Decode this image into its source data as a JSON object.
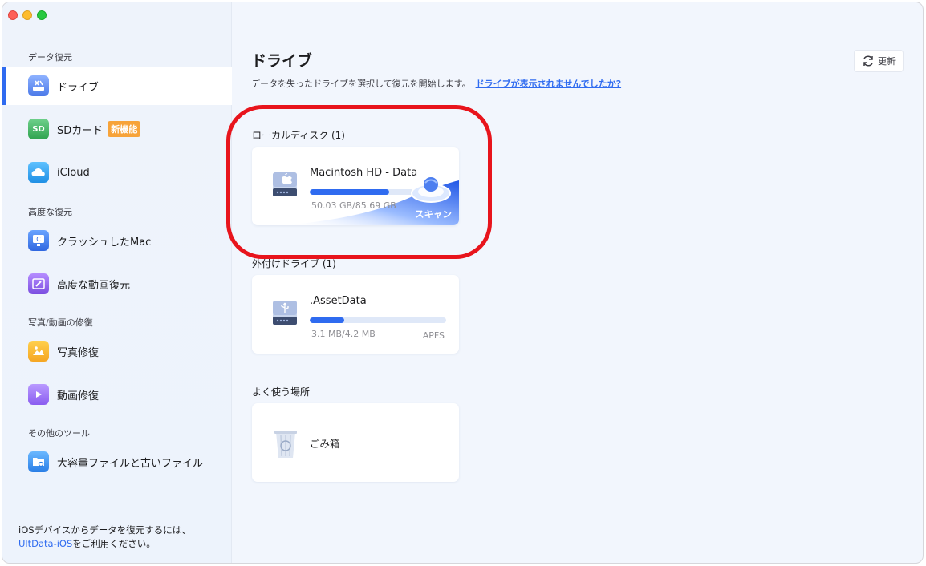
{
  "sidebar": {
    "sections": {
      "data_recovery": "データ復元",
      "advanced_recovery": "高度な復元",
      "photo_video_repair": "写真/動画の修復",
      "other_tools": "その他のツール"
    },
    "items": [
      {
        "label": "ドライブ",
        "icon": "drive-icon",
        "active": true
      },
      {
        "label": "SDカード",
        "icon": "sd-card-icon",
        "badge": "新機能"
      },
      {
        "label": "iCloud",
        "icon": "icloud-icon"
      },
      {
        "label": "クラッシュしたMac",
        "icon": "crashed-mac-icon"
      },
      {
        "label": "高度な動画復元",
        "icon": "advanced-video-icon"
      },
      {
        "label": "写真修復",
        "icon": "photo-repair-icon"
      },
      {
        "label": "動画修復",
        "icon": "video-repair-icon"
      },
      {
        "label": "大容量ファイルと古いファイル",
        "icon": "large-files-icon"
      }
    ],
    "footer": {
      "text": "iOSデバイスからデータを復元するには、",
      "link": "UltData-iOS",
      "suffix": "をご利用ください。"
    }
  },
  "main": {
    "title": "ドライブ",
    "subtitle": "データを失ったドライブを選択して復元を開始します。",
    "help_link": "ドライブが表示されませんでしたか?",
    "refresh_label": "更新",
    "groups": {
      "local": "ローカルディスク (1)",
      "external": "外付けドライブ (1)",
      "frequent": "よく使う場所"
    },
    "local_drive": {
      "name": "Macintosh HD - Data",
      "size": "50.03 GB/85.69 GB",
      "used_fraction": 0.58,
      "scan_label": "スキャン"
    },
    "external_drive": {
      "name": ".AssetData",
      "size": "3.1 MB/4.2 MB",
      "fs": "APFS",
      "used_fraction": 0.25
    },
    "trash": {
      "name": "ごみ箱"
    }
  },
  "colors": {
    "accent": "#2f6bf0",
    "highlight": "#e8141c",
    "badge": "#f7a33a"
  }
}
